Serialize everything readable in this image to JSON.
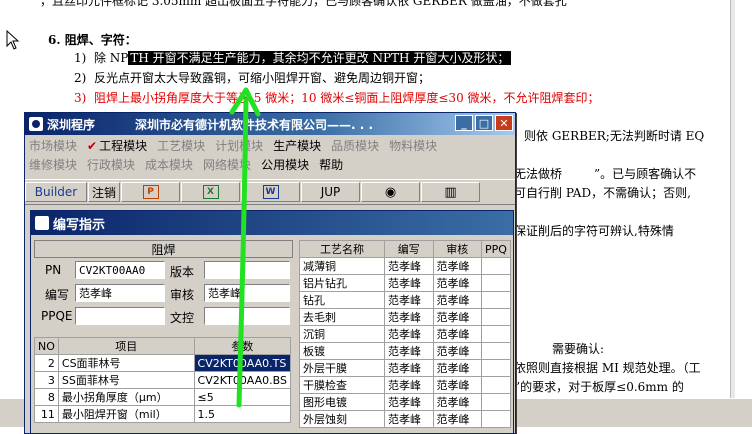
{
  "document": {
    "top_line": "，且丝印元件框标记 3.05mm 超出板面五字符能力，已与顾客确认依 GERBER 做盖油，不做套孔",
    "heading": "6.  阻焊、字符：",
    "items": [
      {
        "num": "1)",
        "pre": "除 NP",
        "highlight": "TH 开窗不满足生产能力，其余均不允许更改 NPTH 开窗大小及形状；"
      },
      {
        "num": "2)",
        "text": "反光点开窗太大导致露铜，可缩小阻焊开窗、避免周边铜开窗；"
      },
      {
        "num": "3)",
        "text": "阻焊上最小拐角厚度大于等于 5 微米；10 微米≤铜面上阻焊厚度≤30 微米，不允许阻焊套印；"
      }
    ],
    "right_lines": [
      "则依 GERBER;无法判断时请 EQ",
      "无法做桥",
      "”。已与顾客确认不",
      "可自行削 PAD，不需确认；否则,",
      "保证削后的字符可辨认,特殊情",
      "需要确认:",
      "依照则直接根据 MI 规范处理。（工",
      "”的要求，对于板厚≤0.6mm 的"
    ]
  },
  "window": {
    "title_left": "深圳程序",
    "title_right": "深圳市必有德计",
    "title_tail": "机软件技术有限公司——. . .",
    "menu_row1": [
      "市场模块",
      "工程模块",
      "工艺模块",
      "计划模块",
      "生产模块",
      "品质模块",
      "物料模块"
    ],
    "menu_row2": [
      "维修模块",
      "行政模块",
      "成本模块",
      "网络模块",
      "公用模块",
      "帮助"
    ],
    "toolbar": {
      "builder": "Builder",
      "logout": "注销",
      "jup": "JUP"
    }
  },
  "child": {
    "title": "编写指示",
    "form_head": "阻焊",
    "pn_label": "PN",
    "pn_value": "CV2KT00AA0",
    "version_label": "版本",
    "author_label": "编写",
    "author_value": "范孝峰",
    "review_label": "审核",
    "review_value": "范孝峰",
    "ppqe_label": "PPQE",
    "wentong_label": "文控",
    "param_headers": [
      "NO",
      "项目",
      "参数"
    ],
    "params": [
      {
        "no": "2",
        "item": "CS面菲林号",
        "value": "CV2KT00AA0.TS"
      },
      {
        "no": "3",
        "item": "SS面菲林号",
        "value": "CV2KT00AA0.BS"
      },
      {
        "no": "8",
        "item": "最小拐角厚度（μm）",
        "value": "≤5"
      },
      {
        "no": "11",
        "item": "最小阻焊开窗（mil）",
        "value": "1.5"
      }
    ],
    "process_headers": [
      "工艺名称",
      "编写",
      "审核",
      "PPQ"
    ],
    "processes": [
      {
        "name": "减薄铜",
        "author": "范孝峰",
        "review": "范孝峰"
      },
      {
        "name": "铝片钻孔",
        "author": "范孝峰",
        "review": "范孝峰"
      },
      {
        "name": "钻孔",
        "author": "范孝峰",
        "review": "范孝峰"
      },
      {
        "name": "去毛刺",
        "author": "范孝峰",
        "review": "范孝峰"
      },
      {
        "name": "沉铜",
        "author": "范孝峰",
        "review": "范孝峰"
      },
      {
        "name": "板镀",
        "author": "范孝峰",
        "review": "范孝峰"
      },
      {
        "name": "外层干膜",
        "author": "范孝峰",
        "review": "范孝峰"
      },
      {
        "name": "干膜检查",
        "author": "范孝峰",
        "review": "范孝峰"
      },
      {
        "name": "图形电镀",
        "author": "范孝峰",
        "review": "范孝峰"
      },
      {
        "name": "外层蚀刻",
        "author": "范孝峰",
        "review": "范孝峰"
      }
    ]
  },
  "colors": {
    "arrow": "#22e022",
    "title_blue": "#0a246a",
    "red_text": "#e00000"
  }
}
